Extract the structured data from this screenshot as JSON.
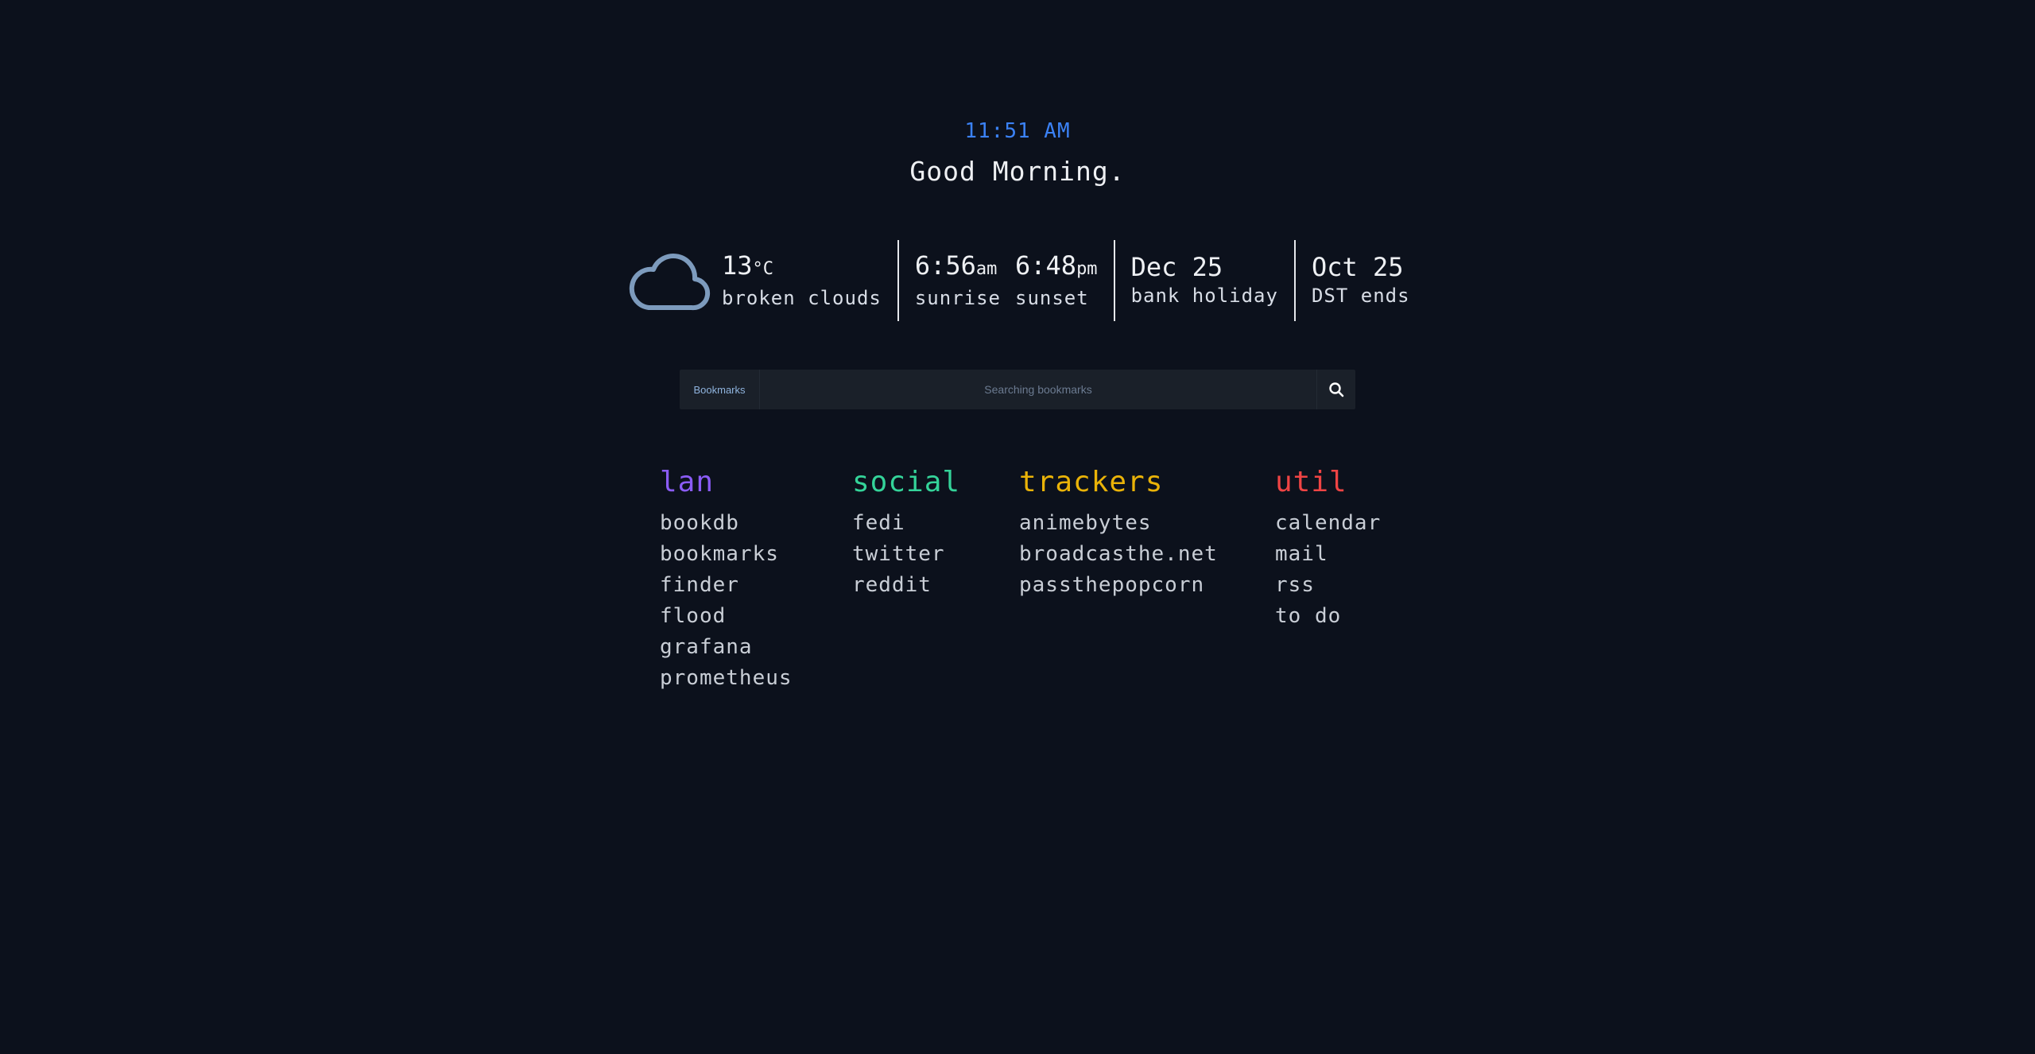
{
  "clock": {
    "time": "11:51 AM"
  },
  "greeting": "Good Morning.",
  "weather": {
    "icon": "cloud-icon",
    "temperature": "13",
    "unit": "°C",
    "description": "broken clouds"
  },
  "sun": {
    "sunrise_time": "6:56",
    "sunrise_suffix": "am",
    "sunrise_label": "sunrise",
    "sunset_time": "6:48",
    "sunset_suffix": "pm",
    "sunset_label": "sunset"
  },
  "events": [
    {
      "date": "Dec 25",
      "label": "bank holiday"
    },
    {
      "date": "Oct 25",
      "label": "DST ends"
    }
  ],
  "search": {
    "scope_label": "Bookmarks",
    "placeholder": "Searching bookmarks",
    "icon": "search-icon"
  },
  "categories": [
    {
      "title": "lan",
      "color": "#8b5cf6",
      "links": [
        "bookdb",
        "bookmarks",
        "finder",
        "flood",
        "grafana",
        "prometheus"
      ]
    },
    {
      "title": "social",
      "color": "#34d399",
      "links": [
        "fedi",
        "twitter",
        "reddit"
      ]
    },
    {
      "title": "trackers",
      "color": "#eab308",
      "links": [
        "animebytes",
        "broadcasthe.net",
        "passthepopcorn"
      ]
    },
    {
      "title": "util",
      "color": "#ef4444",
      "links": [
        "calendar",
        "mail",
        "rss",
        "to do"
      ]
    }
  ],
  "colors": {
    "background": "#0c111c",
    "clock": "#3b82f6",
    "search_bg": "#1a2029",
    "cloud_stroke": "#7d9bbd"
  }
}
